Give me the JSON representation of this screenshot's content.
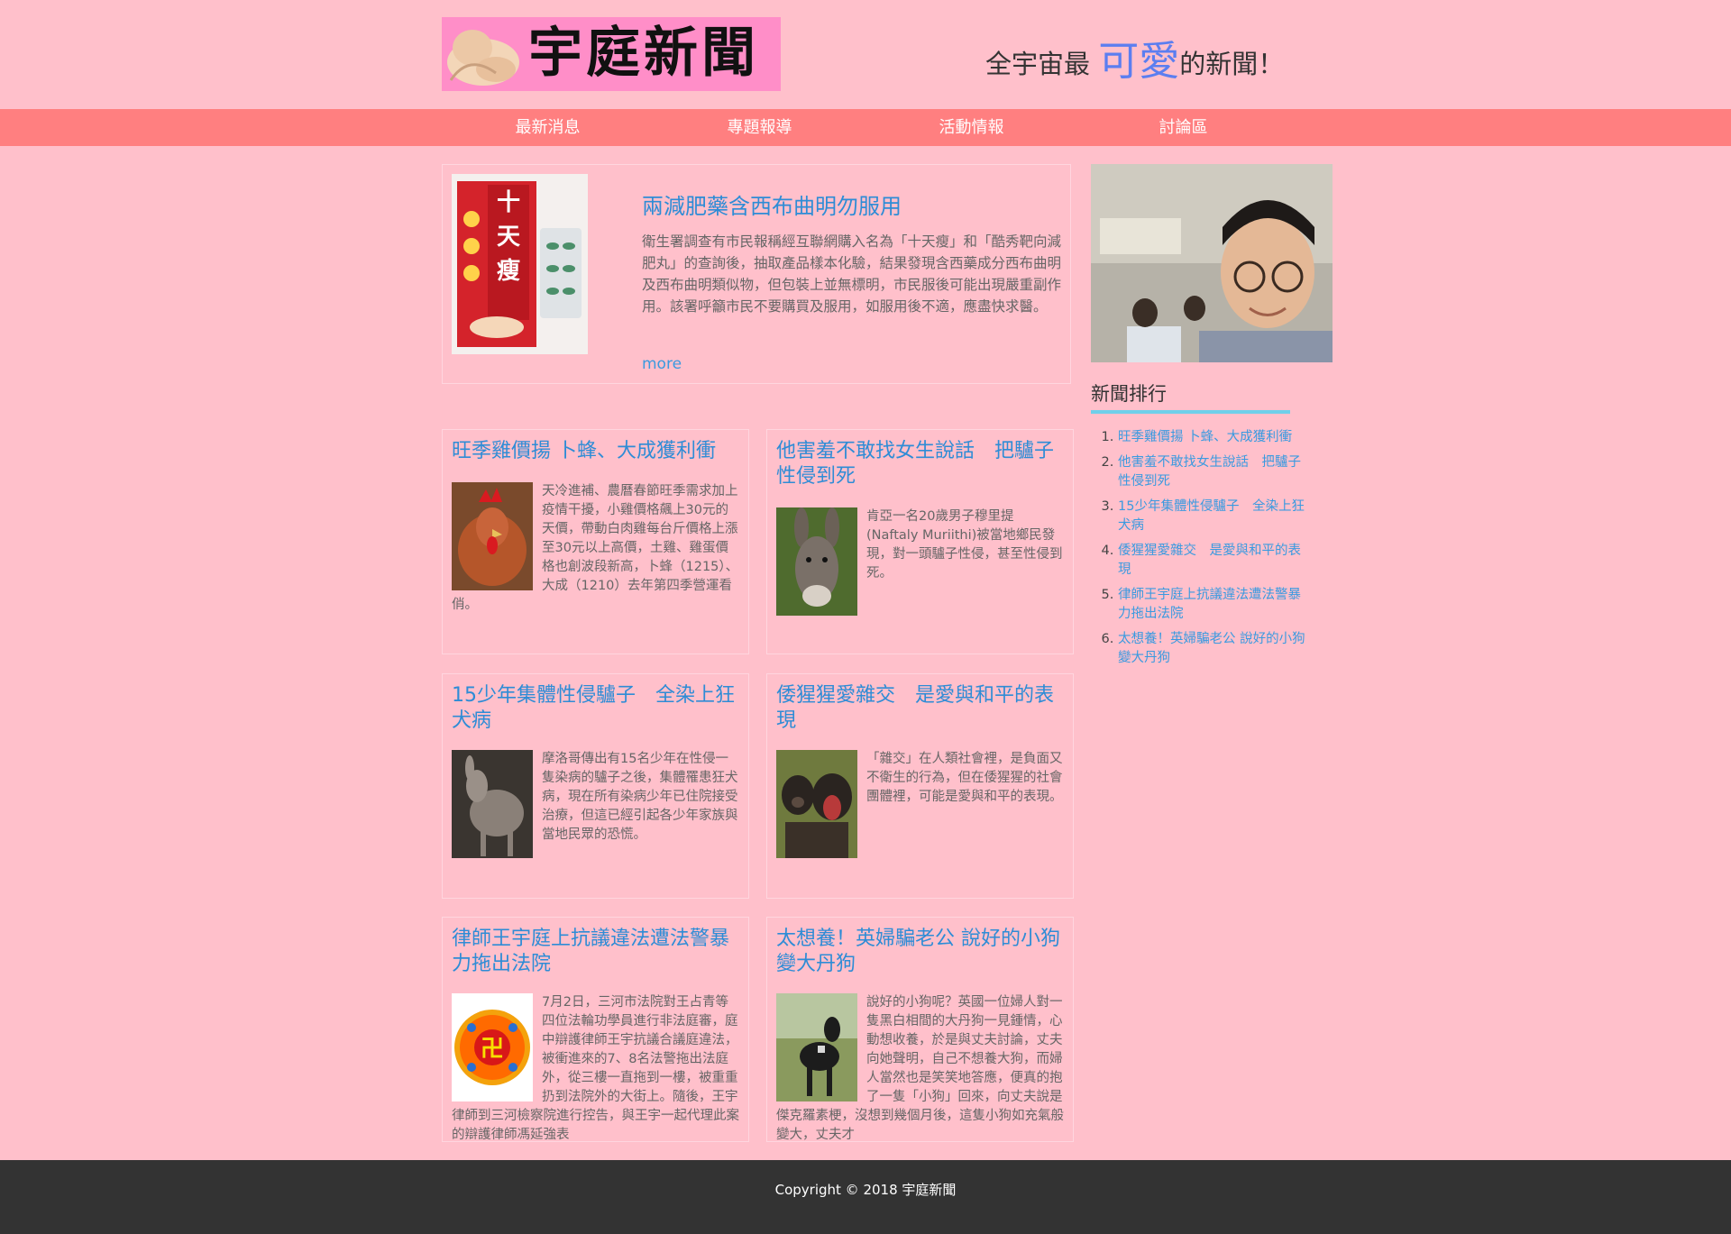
{
  "header": {
    "logo_text": "宇庭新聞",
    "slogan_pre": "全宇宙最 ",
    "slogan_em": "可愛",
    "slogan_post": "的新聞！"
  },
  "nav": [
    "最新消息",
    "專題報導",
    "活動情報",
    "討論區"
  ],
  "featured": {
    "title": "兩減肥藥含西布曲明勿服用",
    "body": "衛生署調查有市民報稱經互聯網購入名為「十天瘦」和「酷秀靶向減肥丸」的查詢後，抽取產品樣本化驗，結果發現含西藥成分西布曲明及西布曲明類似物，但包裝上並無標明，市民服後可能出現嚴重副作用。該署呼籲市民不要購買及服用，如服用後不適，應盡快求醫。",
    "more": "more",
    "image_label": "十天瘦"
  },
  "cards": [
    {
      "title": "旺季雞價揚 卜蜂、大成獲利衝",
      "text": "天冷進補、農曆春節旺季需求加上疫情干擾，小雞價格飆上30元的天價，帶動白肉雞每台斤價格上漲至30元以上高價，土雞、雞蛋價格也創波段新高，卜蜂（1215）、大成（1210）去年第四季營運看俏。",
      "icon": "rooster-icon"
    },
    {
      "title": "他害羞不敢找女生說話　把驢子性侵到死",
      "text": "肯亞一名20歲男子穆里提(Naftaly Muriithi)被當地鄉民發現，對一頭驢子性侵，甚至性侵到死。",
      "icon": "donkey-icon"
    },
    {
      "title": "15少年集體性侵驢子　全染上狂犬病",
      "text": "摩洛哥傳出有15名少年在性侵一隻染病的驢子之後，集體罹患狂犬病，現在所有染病少年已住院接受治療，但這已經引起各少年家族與當地民眾的恐慌。",
      "icon": "donkey-icon"
    },
    {
      "title": "倭猩猩愛雜交　是愛與和平的表現",
      "text": "「雜交」在人類社會裡，是負面又不衛生的行為，但在倭猩猩的社會團體裡，可能是愛與和平的表現。",
      "icon": "bonobo-icon"
    },
    {
      "title": "律師王宇庭上抗議違法遭法警暴力拖出法院",
      "text": "7月2日，三河市法院對王占青等四位法輪功學員進行非法庭審，庭中辯護律師王宇抗議合議庭違法，被衝進來的7、8名法警拖出法庭外，從三樓一直拖到一樓，被重重扔到法院外的大街上。隨後，王宇律師到三河檢察院進行控告，與王宇一起代理此案的辯護律師馮延強表",
      "icon": "emblem-icon"
    },
    {
      "title": "太想養！英婦騙老公 說好的小狗變大丹狗",
      "text": "說好的小狗呢？英國一位婦人對一隻黑白相間的大丹狗一見鍾情，心動想收養，於是與丈夫討論，丈夫向她聲明，自己不想養大狗，而婦人當然也是笑笑地答應，便真的抱了一隻「小狗」回來，向丈夫說是傑克羅素梗，沒想到幾個月後，這隻小狗如充氣般變大，丈夫才",
      "icon": "great-dane-icon"
    }
  ],
  "sidebar": {
    "heading": "新聞排行",
    "ranking": [
      "旺季雞價揚 卜蜂、大成獲利衝",
      "他害羞不敢找女生說話　把驢子性侵到死",
      "15少年集體性侵驢子　全染上狂犬病",
      "倭猩猩愛雜交　是愛與和平的表現",
      "律師王宇庭上抗議違法遭法警暴力拖出法院",
      "太想養！英婦騙老公 說好的小狗變大丹狗"
    ]
  },
  "footer": {
    "copyright": "Copyright © 2018 宇庭新聞"
  },
  "colors": {
    "page_bg": "#ffc0cb",
    "nav_bg": "#ff7f80",
    "link": "#2e8cd6",
    "accent_underline": "#6fd0ea",
    "footer_bg": "#333333"
  }
}
